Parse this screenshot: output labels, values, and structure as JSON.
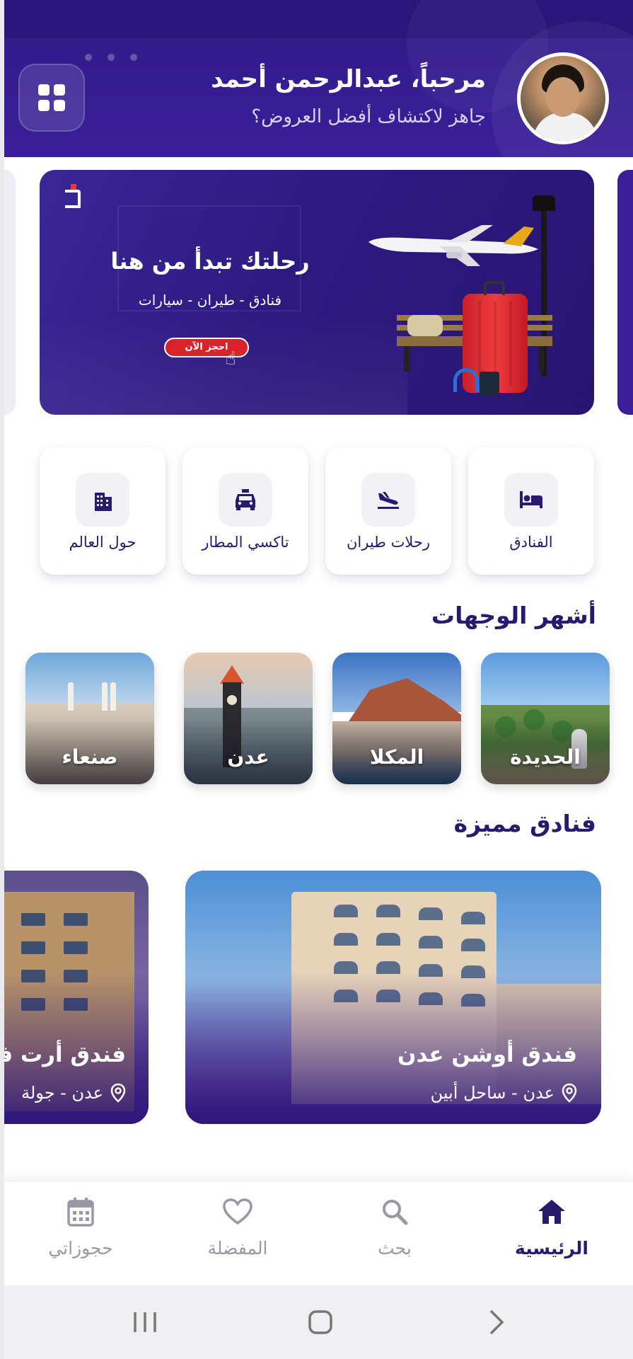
{
  "header": {
    "greeting": "مرحباً، عبدالرحمن أحمد",
    "subtitle": "جاهز لاكتشاف أفضل العروض؟",
    "menu_icon": "grid-icon"
  },
  "banner": {
    "title": "رحلتك تبدأ من هنا",
    "services": "فنادق - طيران - سيارات",
    "cta": "احجز الآن"
  },
  "services": [
    {
      "label": "الفنادق",
      "icon": "bed-icon"
    },
    {
      "label": "رحلات طيران",
      "icon": "plane-landing-icon"
    },
    {
      "label": "تاكسي المطار",
      "icon": "taxi-icon"
    },
    {
      "label": "حول العالم",
      "icon": "building-icon"
    }
  ],
  "destinations": {
    "title": "أشهر الوجهات",
    "items": [
      {
        "name": "الحديدة"
      },
      {
        "name": "المكلا"
      },
      {
        "name": "عدن"
      },
      {
        "name": "صنعاء"
      }
    ]
  },
  "featured": {
    "title": "فنادق مميزة",
    "hotels": [
      {
        "name": "فندق أوشن عدن",
        "location": "عدن - ساحل أبين"
      },
      {
        "name": "فندق أرت فيو",
        "location": "عدن - جولة"
      }
    ]
  },
  "bottom_nav": [
    {
      "label": "الرئيسية",
      "icon": "home-icon",
      "active": true
    },
    {
      "label": "بحث",
      "icon": "search-icon",
      "active": false
    },
    {
      "label": "المفضلة",
      "icon": "heart-icon",
      "active": false
    },
    {
      "label": "حجوزاتي",
      "icon": "calendar-icon",
      "active": false
    }
  ],
  "colors": {
    "primary": "#2f1a86",
    "text_dark": "#2a1a6e",
    "accent_red": "#d8232a",
    "inactive": "#9a98a4"
  }
}
